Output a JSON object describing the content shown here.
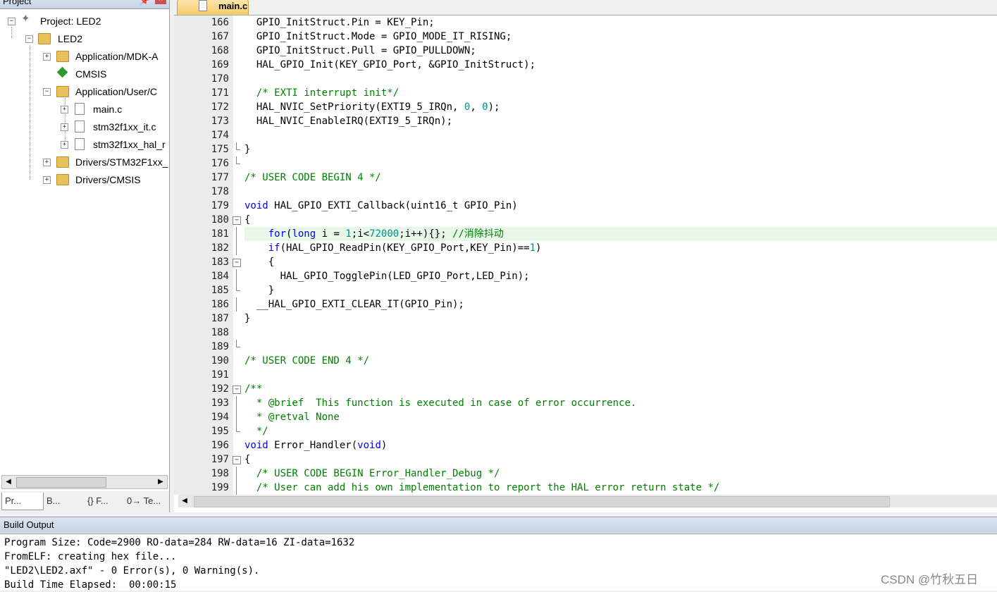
{
  "project_panel": {
    "title": "Project",
    "pin_glyph": "📌",
    "close_glyph": "×",
    "tree": [
      {
        "label": "Project: LED2",
        "icon": "project-icon"
      },
      {
        "label": "LED2",
        "icon": "target-icon"
      },
      {
        "label": "Application/MDK-A",
        "icon": "folder-icon"
      },
      {
        "label": "CMSIS",
        "icon": "gem-icon"
      },
      {
        "label": "Application/User/C",
        "icon": "folder-icon"
      },
      {
        "label": "main.c",
        "icon": "file-icon"
      },
      {
        "label": "stm32f1xx_it.c",
        "icon": "file-icon"
      },
      {
        "label": "stm32f1xx_hal_r",
        "icon": "file-icon"
      },
      {
        "label": "Drivers/STM32F1xx_",
        "icon": "folder-icon"
      },
      {
        "label": "Drivers/CMSIS",
        "icon": "folder-icon"
      }
    ],
    "tabs": [
      "Pr...",
      "B...",
      "{} F...",
      "0→ Te..."
    ]
  },
  "editor": {
    "tab_label": "main.c",
    "highlighted_line": "181",
    "lines": [
      {
        "n": "166",
        "t": "  GPIO_InitStruct.Pin = KEY_Pin;"
      },
      {
        "n": "167",
        "t": "  GPIO_InitStruct.Mode = GPIO_MODE_IT_RISING;"
      },
      {
        "n": "168",
        "t": "  GPIO_InitStruct.Pull = GPIO_PULLDOWN;"
      },
      {
        "n": "169",
        "t": "  HAL_GPIO_Init(KEY_GPIO_Port, &GPIO_InitStruct);"
      },
      {
        "n": "170",
        "t": ""
      },
      {
        "n": "171",
        "t": "  /* EXTI interrupt init*/"
      },
      {
        "n": "172",
        "t": "  HAL_NVIC_SetPriority(EXTI9_5_IRQn, 0, 0);"
      },
      {
        "n": "173",
        "t": "  HAL_NVIC_EnableIRQ(EXTI9_5_IRQn);"
      },
      {
        "n": "174",
        "t": ""
      },
      {
        "n": "175",
        "t": "}"
      },
      {
        "n": "176",
        "t": ""
      },
      {
        "n": "177",
        "t": "/* USER CODE BEGIN 4 */"
      },
      {
        "n": "178",
        "t": ""
      },
      {
        "n": "179",
        "t": "void HAL_GPIO_EXTI_Callback(uint16_t GPIO_Pin)"
      },
      {
        "n": "180",
        "t": "{"
      },
      {
        "n": "181",
        "t": "    for(long i = 1;i<72000;i++){}; //消除抖动"
      },
      {
        "n": "182",
        "t": "    if(HAL_GPIO_ReadPin(KEY_GPIO_Port,KEY_Pin)==1)"
      },
      {
        "n": "183",
        "t": "    {"
      },
      {
        "n": "184",
        "t": "      HAL_GPIO_TogglePin(LED_GPIO_Port,LED_Pin);"
      },
      {
        "n": "185",
        "t": "    }"
      },
      {
        "n": "186",
        "t": "  __HAL_GPIO_EXTI_CLEAR_IT(GPIO_Pin);"
      },
      {
        "n": "187",
        "t": "}"
      },
      {
        "n": "188",
        "t": ""
      },
      {
        "n": "189",
        "t": ""
      },
      {
        "n": "190",
        "t": "/* USER CODE END 4 */"
      },
      {
        "n": "191",
        "t": ""
      },
      {
        "n": "192",
        "t": "/**"
      },
      {
        "n": "193",
        "t": "  * @brief  This function is executed in case of error occurrence."
      },
      {
        "n": "194",
        "t": "  * @retval None"
      },
      {
        "n": "195",
        "t": "  */"
      },
      {
        "n": "196",
        "t": "void Error_Handler(void)"
      },
      {
        "n": "197",
        "t": "{"
      },
      {
        "n": "198",
        "t": "  /* USER CODE BEGIN Error_Handler_Debug */"
      },
      {
        "n": "199",
        "t": "  /* User can add his own implementation to report the HAL error return state */"
      }
    ]
  },
  "build_output": {
    "title": "Build Output",
    "lines": [
      "Program Size: Code=2900 RO-data=284 RW-data=16 ZI-data=1632",
      "FromELF: creating hex file...",
      "\"LED2\\LED2.axf\" - 0 Error(s), 0 Warning(s).",
      "Build Time Elapsed:  00:00:15"
    ]
  },
  "watermark": "CSDN @竹秋五日"
}
